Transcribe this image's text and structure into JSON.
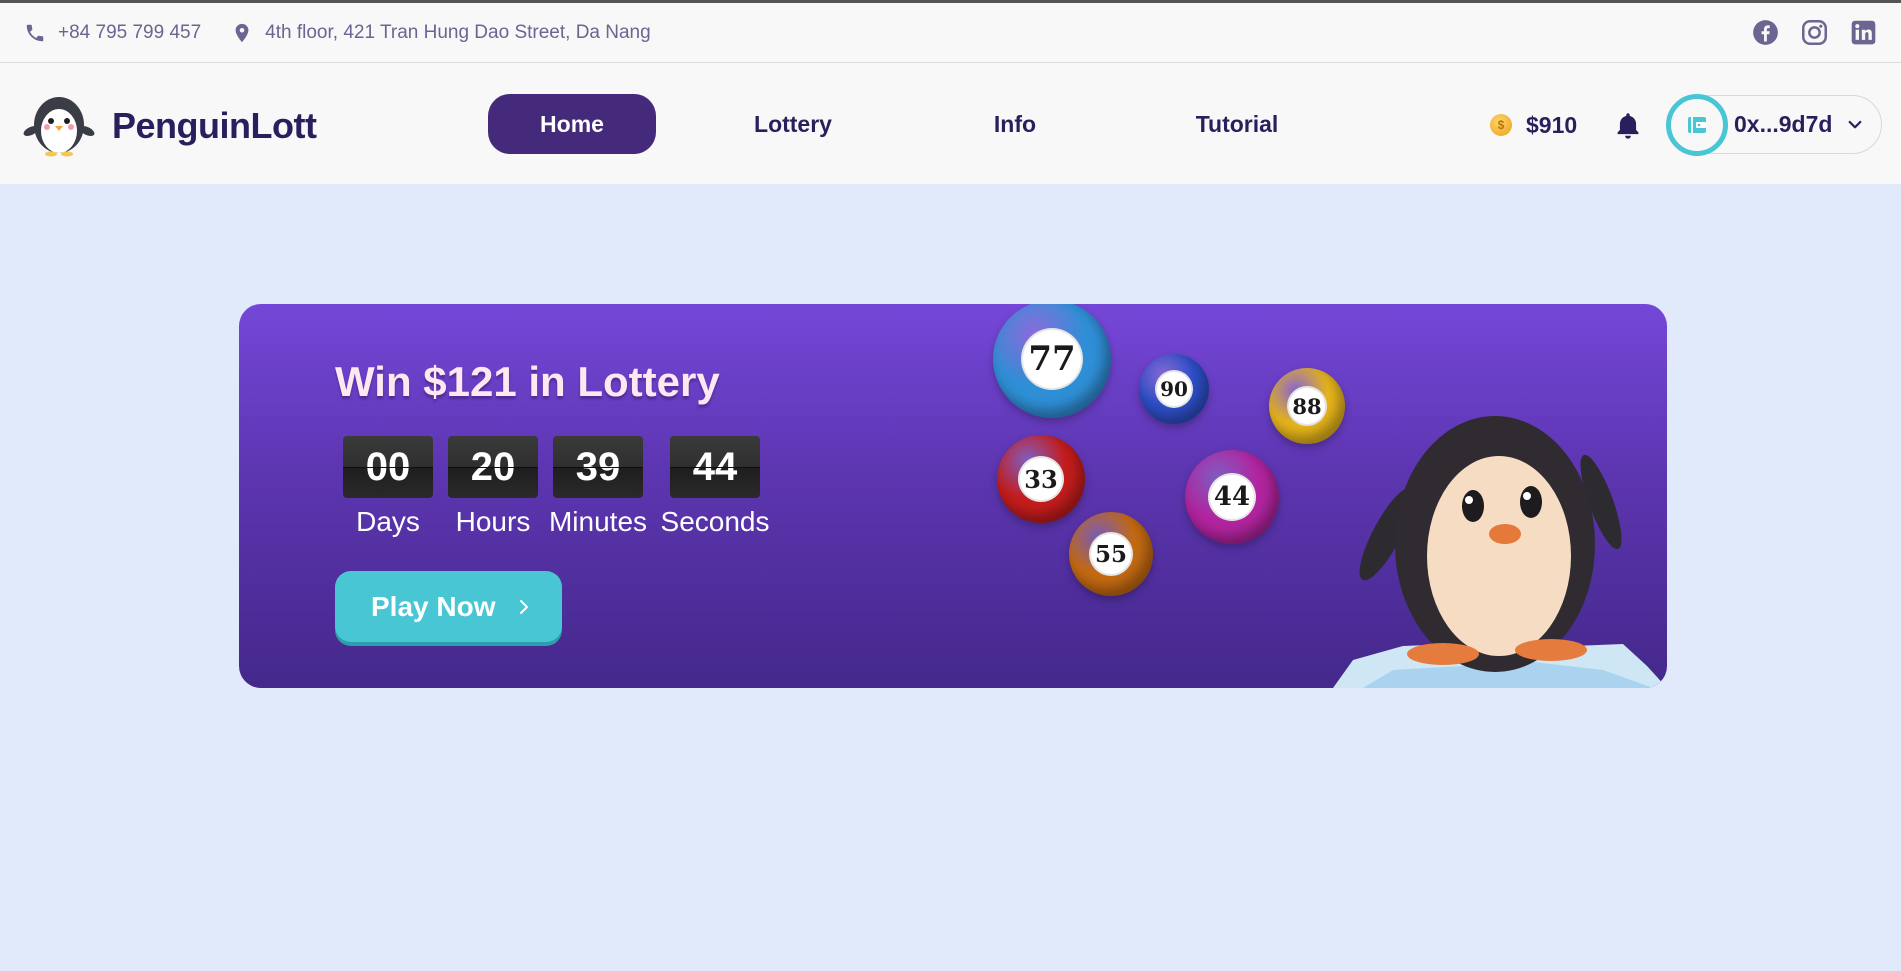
{
  "topbar": {
    "phone": "+84 795 799 457",
    "address": "4th floor, 421 Tran Hung Dao Street, Da Nang",
    "socials": [
      "facebook-icon",
      "instagram-icon",
      "linkedin-icon"
    ]
  },
  "brand": {
    "name": "PenguinLott"
  },
  "nav": {
    "items": [
      {
        "label": "Home",
        "active": true
      },
      {
        "label": "Lottery",
        "active": false
      },
      {
        "label": "Info",
        "active": false
      },
      {
        "label": "Tutorial",
        "active": false
      }
    ]
  },
  "account": {
    "balance": "$910",
    "wallet_address": "0x...9d7d"
  },
  "banner": {
    "title": "Win $121 in Lottery",
    "countdown": [
      {
        "value": "00",
        "label": "Days"
      },
      {
        "value": "20",
        "label": "Hours"
      },
      {
        "value": "39",
        "label": "Minutes"
      },
      {
        "value": "44",
        "label": "Seconds"
      }
    ],
    "cta_label": "Play Now",
    "balls": [
      {
        "number": "77",
        "color": "#2f8fd6"
      },
      {
        "number": "90",
        "color": "#2d4fc7"
      },
      {
        "number": "88",
        "color": "#e7b51b"
      },
      {
        "number": "33",
        "color": "#c41c1c"
      },
      {
        "number": "44",
        "color": "#b2249f"
      },
      {
        "number": "55",
        "color": "#c46a12"
      }
    ]
  },
  "colors": {
    "primary": "#45297a",
    "accent": "#48c6d4",
    "text_dark": "#2a1f5c",
    "page_bg": "#e1eafb"
  }
}
